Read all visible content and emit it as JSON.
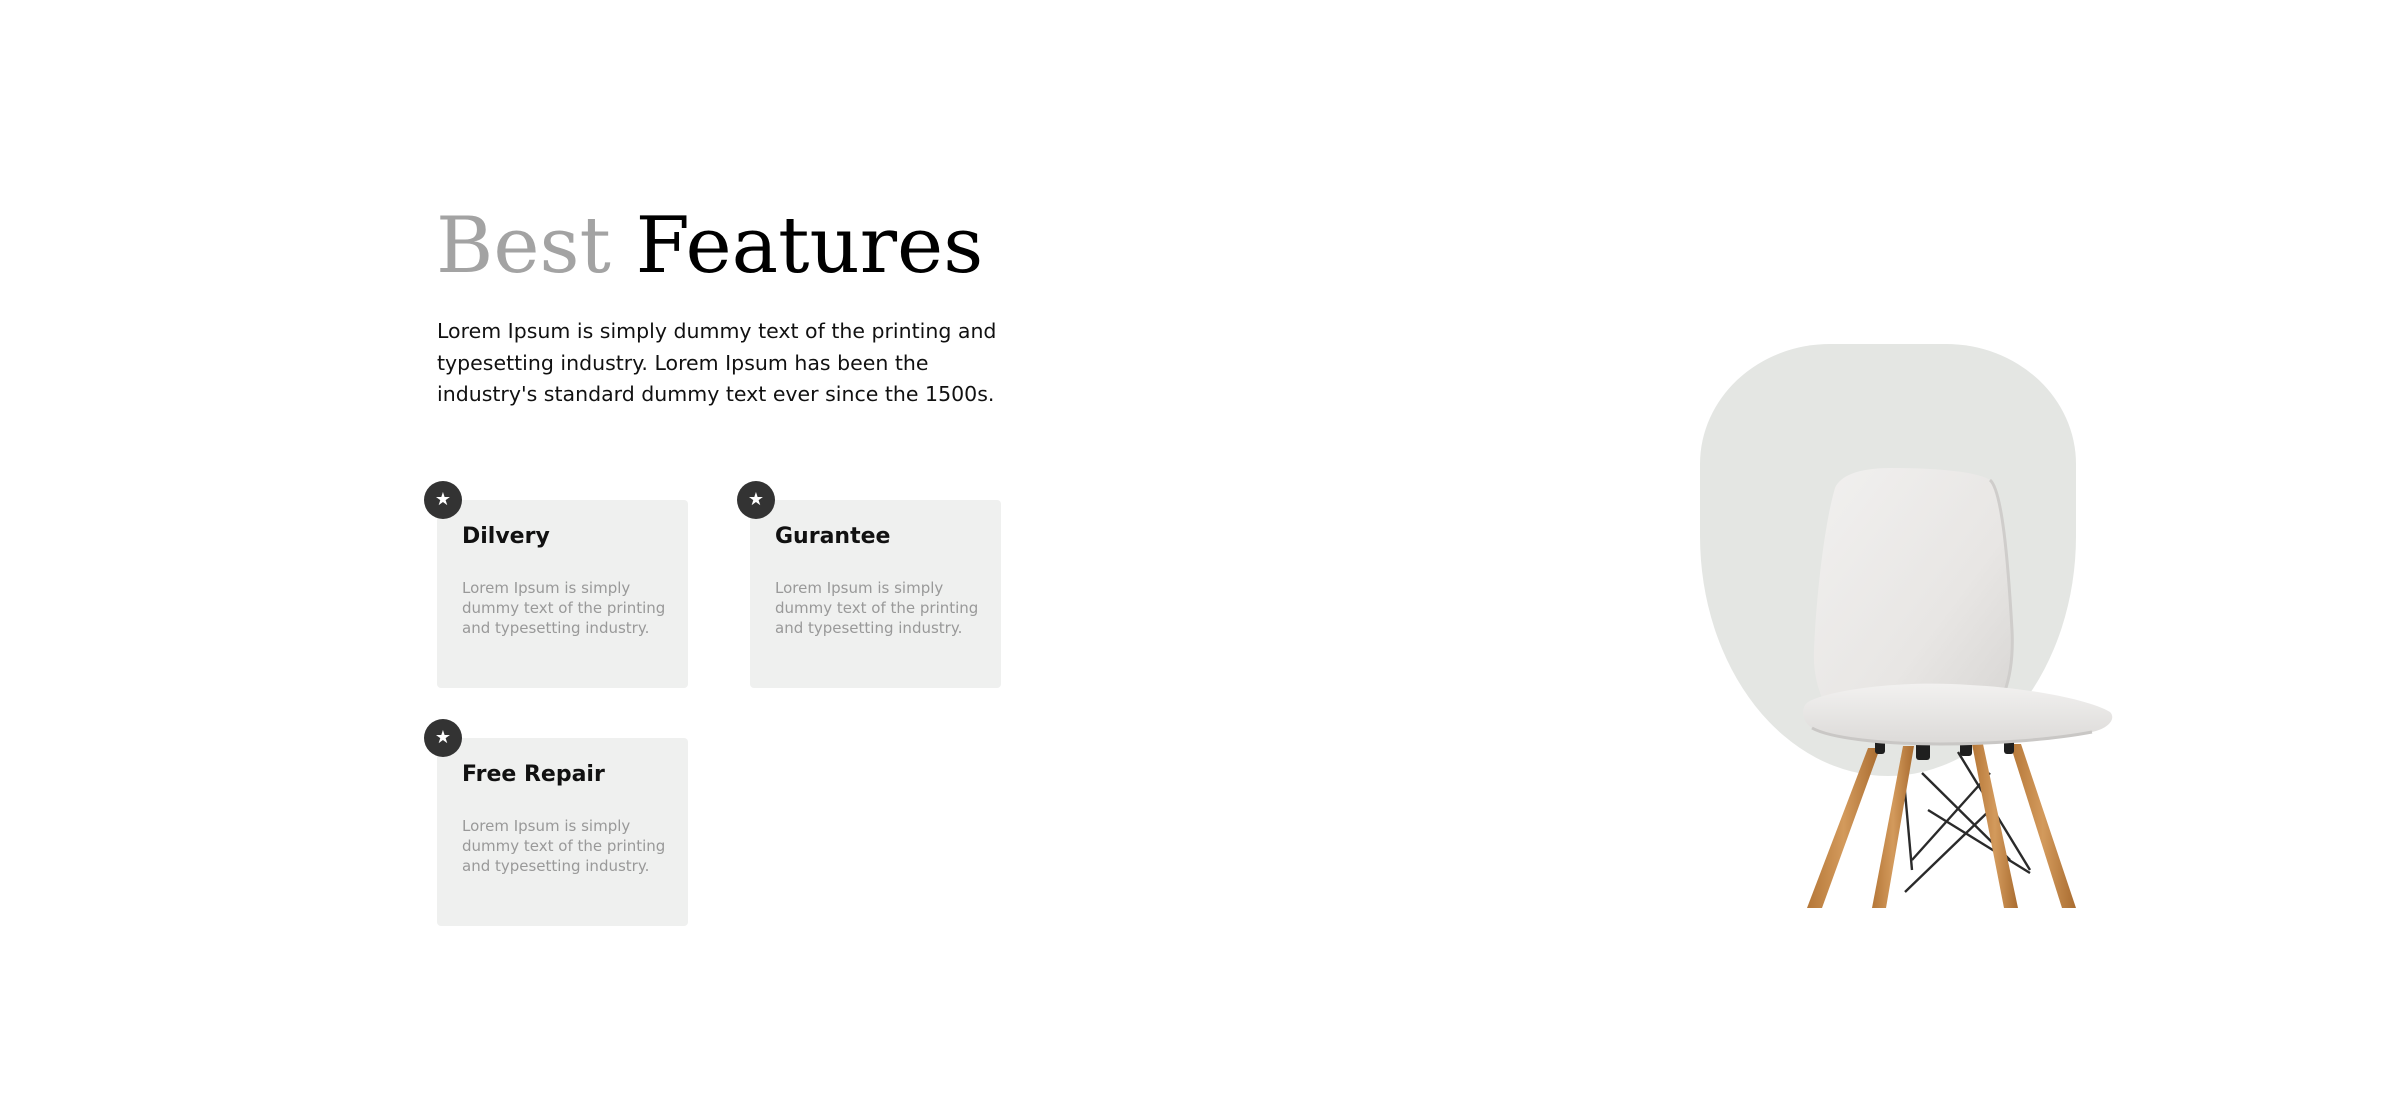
{
  "heading": {
    "light": "Best",
    "dark": "Features"
  },
  "intro": "Lorem Ipsum is simply dummy text of the printing and typesetting industry. Lorem Ipsum has been the industry's standard dummy text ever since the 1500s.",
  "features": [
    {
      "icon": "star-icon",
      "title": "Dilvery",
      "text": "Lorem Ipsum is simply dummy text of the printing and typesetting industry."
    },
    {
      "icon": "star-icon",
      "title": "Gurantee",
      "text": "Lorem Ipsum is simply dummy text of the printing and typesetting industry."
    },
    {
      "icon": "star-icon",
      "title": "Free Repair",
      "text": "Lorem Ipsum is simply dummy text of the printing and typesetting industry."
    }
  ],
  "product_image": {
    "subject": "white chair with wooden legs"
  },
  "colors": {
    "card_background": "#eff0ef",
    "badge_background": "#333333",
    "heading_light": "#a3a3a3",
    "heading_dark": "#000000",
    "backdrop": "#e4e6e3",
    "wood": "#c88a4a"
  }
}
